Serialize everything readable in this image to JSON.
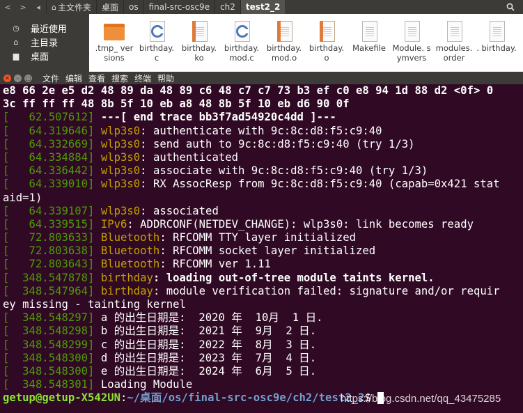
{
  "file_manager": {
    "nav_back": "<",
    "nav_forward": ">",
    "nav_prev": "◂",
    "breadcrumbs": [
      {
        "label": "主文件夹",
        "icon": "home-icon"
      },
      {
        "label": "桌面"
      },
      {
        "label": "os"
      },
      {
        "label": "final-src-osc9e"
      },
      {
        "label": "ch2"
      },
      {
        "label": "test2_2"
      }
    ],
    "search_icon": "search-icon",
    "sidebar": [
      {
        "label": "最近使用",
        "icon": "clock-icon"
      },
      {
        "label": "主目录",
        "icon": "home-icon"
      },
      {
        "label": "桌面",
        "icon": "desktop-folder-icon"
      }
    ],
    "files": [
      {
        "name": ".tmp_ versions",
        "icon": "folder-icon"
      },
      {
        "name": "birthday. c",
        "icon": "c-source-icon"
      },
      {
        "name": "birthday. ko",
        "icon": "object-file-icon"
      },
      {
        "name": "birthday. mod.c",
        "icon": "c-source-icon"
      },
      {
        "name": "birthday. mod.o",
        "icon": "object-file-icon"
      },
      {
        "name": "birthday. o",
        "icon": "object-file-icon"
      },
      {
        "name": "Makefile",
        "icon": "text-file-icon"
      },
      {
        "name": "Module. symvers",
        "icon": "text-file-icon"
      },
      {
        "name": "modules. order",
        "icon": "text-file-icon"
      },
      {
        "name": ". birthday.",
        "icon": "text-file-icon"
      }
    ]
  },
  "terminal": {
    "menu": [
      "文件",
      "编辑",
      "查看",
      "搜索",
      "终端",
      "帮助"
    ],
    "lines": [
      {
        "spans": [
          {
            "t": "e8 66 2e e5 d2 48 89 da 48 89 c6 48 c7 c7 73 b3 ef c0 e8 94 1d 88 d2 <0f> 0",
            "c": "bold"
          }
        ]
      },
      {
        "spans": [
          {
            "t": "3c ff ff ff 48 8b 5f 10 eb a8 48 8b 5f 10 eb d6 90 0f",
            "c": "bold"
          }
        ]
      },
      {
        "spans": [
          {
            "t": "[   62.507612] ",
            "c": "ts"
          },
          {
            "t": "---[ end trace bb3f7ad54920c4dd ]---",
            "c": "bold"
          }
        ]
      },
      {
        "spans": [
          {
            "t": "[   64.319646] ",
            "c": "ts"
          },
          {
            "t": "wlp3s0",
            "c": "yel"
          },
          {
            "t": ": authenticate with 9c:8c:d8:f5:c9:40",
            "c": ""
          }
        ]
      },
      {
        "spans": [
          {
            "t": "[   64.332669] ",
            "c": "ts"
          },
          {
            "t": "wlp3s0",
            "c": "yel"
          },
          {
            "t": ": send auth to 9c:8c:d8:f5:c9:40 (try 1/3)",
            "c": ""
          }
        ]
      },
      {
        "spans": [
          {
            "t": "[   64.334884] ",
            "c": "ts"
          },
          {
            "t": "wlp3s0",
            "c": "yel"
          },
          {
            "t": ": authenticated",
            "c": ""
          }
        ]
      },
      {
        "spans": [
          {
            "t": "[   64.336442] ",
            "c": "ts"
          },
          {
            "t": "wlp3s0",
            "c": "yel"
          },
          {
            "t": ": associate with 9c:8c:d8:f5:c9:40 (try 1/3)",
            "c": ""
          }
        ]
      },
      {
        "spans": [
          {
            "t": "[   64.339010] ",
            "c": "ts"
          },
          {
            "t": "wlp3s0",
            "c": "yel"
          },
          {
            "t": ": RX AssocResp from 9c:8c:d8:f5:c9:40 (capab=0x421 stat",
            "c": ""
          }
        ]
      },
      {
        "spans": [
          {
            "t": "aid=1)",
            "c": ""
          }
        ]
      },
      {
        "spans": [
          {
            "t": "[   64.339107] ",
            "c": "ts"
          },
          {
            "t": "wlp3s0",
            "c": "yel"
          },
          {
            "t": ": associated",
            "c": ""
          }
        ]
      },
      {
        "spans": [
          {
            "t": "[   64.339515] ",
            "c": "ts"
          },
          {
            "t": "IPv6",
            "c": "yel"
          },
          {
            "t": ": ADDRCONF(NETDEV_CHANGE): wlp3s0: link becomes ready",
            "c": ""
          }
        ]
      },
      {
        "spans": [
          {
            "t": "[   72.803633] ",
            "c": "ts"
          },
          {
            "t": "Bluetooth",
            "c": "yel"
          },
          {
            "t": ": RFCOMM TTY layer initialized",
            "c": ""
          }
        ]
      },
      {
        "spans": [
          {
            "t": "[   72.803638] ",
            "c": "ts"
          },
          {
            "t": "Bluetooth",
            "c": "yel"
          },
          {
            "t": ": RFCOMM socket layer initialized",
            "c": ""
          }
        ]
      },
      {
        "spans": [
          {
            "t": "[   72.803643] ",
            "c": "ts"
          },
          {
            "t": "Bluetooth",
            "c": "yel"
          },
          {
            "t": ": RFCOMM ver 1.11",
            "c": ""
          }
        ]
      },
      {
        "spans": [
          {
            "t": "[  348.547878] ",
            "c": "ts"
          },
          {
            "t": "birthday",
            "c": "yel"
          },
          {
            "t": ": loading out-of-tree module taints kernel.",
            "c": "bold"
          }
        ]
      },
      {
        "spans": [
          {
            "t": "[  348.547964] ",
            "c": "ts"
          },
          {
            "t": "birthday",
            "c": "yel"
          },
          {
            "t": ": module verification failed: signature and/or requir",
            "c": ""
          }
        ]
      },
      {
        "spans": [
          {
            "t": "ey missing - tainting kernel",
            "c": ""
          }
        ]
      },
      {
        "spans": [
          {
            "t": "[  348.548297] ",
            "c": "ts"
          },
          {
            "t": "a 的出生日期是:  2020 年  10月  1 日.",
            "c": ""
          }
        ]
      },
      {
        "spans": [
          {
            "t": "[  348.548298] ",
            "c": "ts"
          },
          {
            "t": "b 的出生日期是:  2021 年  9月  2 日.",
            "c": ""
          }
        ]
      },
      {
        "spans": [
          {
            "t": "[  348.548299] ",
            "c": "ts"
          },
          {
            "t": "c 的出生日期是:  2022 年  8月  3 日.",
            "c": ""
          }
        ]
      },
      {
        "spans": [
          {
            "t": "[  348.548300] ",
            "c": "ts"
          },
          {
            "t": "d 的出生日期是:  2023 年  7月  4 日.",
            "c": ""
          }
        ]
      },
      {
        "spans": [
          {
            "t": "[  348.548300] ",
            "c": "ts"
          },
          {
            "t": "e 的出生日期是:  2024 年  6月  5 日.",
            "c": ""
          }
        ]
      },
      {
        "spans": [
          {
            "t": "[  348.548301] ",
            "c": "ts"
          },
          {
            "t": "Loading Module",
            "c": ""
          }
        ]
      }
    ],
    "prompt": {
      "user_host": "getup@getup-X542UN",
      "sep": ":",
      "path": "~/桌面/os/final-src-osc9e/ch2/test2_2",
      "symbol": "$ "
    }
  },
  "watermark": "https://blog.csdn.net/qq_43475285"
}
